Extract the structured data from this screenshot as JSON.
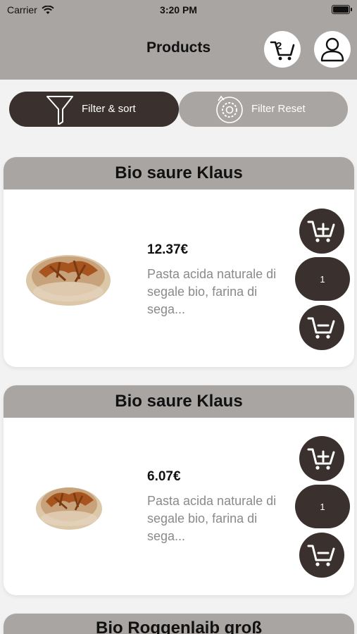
{
  "status_bar": {
    "carrier": "Carrier",
    "time": "3:20 PM"
  },
  "nav": {
    "title": "Products",
    "cart_count": "2"
  },
  "filters": {
    "filter_sort_label": "Filter & sort",
    "filter_reset_label": "Filter Reset"
  },
  "products": [
    {
      "name": "Bio saure Klaus",
      "price": "12.37€",
      "description": "Pasta acida naturale di segale bio, farina di sega...",
      "quantity": "1"
    },
    {
      "name": "Bio saure Klaus",
      "price": "6.07€",
      "description": "Pasta acida naturale di segale bio, farina di sega...",
      "quantity": "1"
    },
    {
      "name": "Bio Roggenlaib groß"
    }
  ],
  "colors": {
    "header_gray": "#a8a5a3",
    "dark_brown": "#3a302e",
    "background": "#f2f2f2"
  }
}
